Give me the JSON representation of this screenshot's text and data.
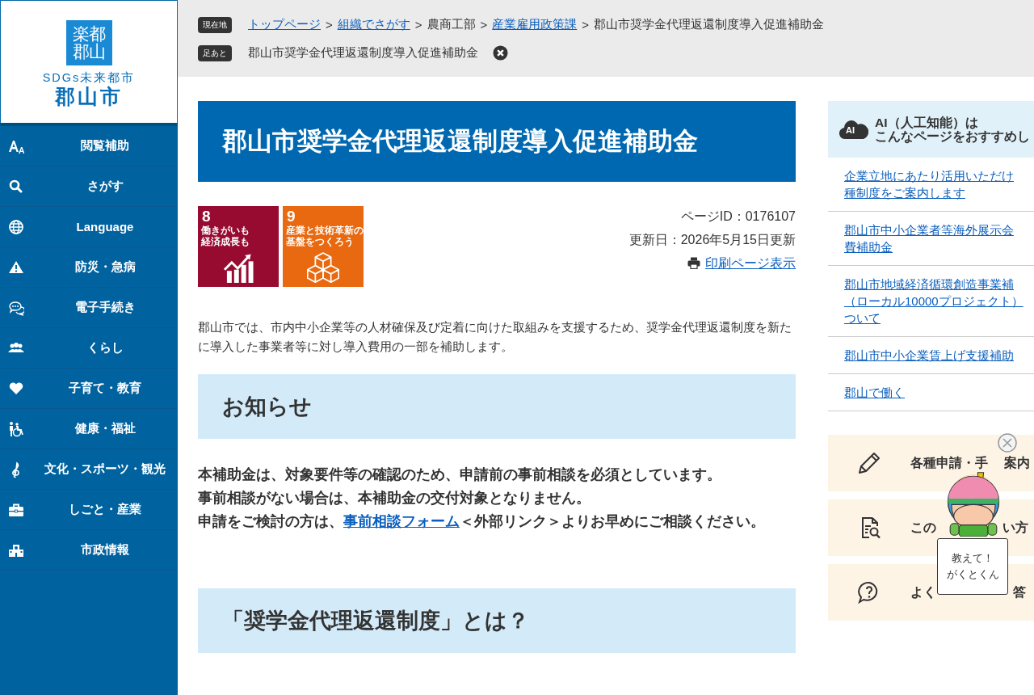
{
  "logo": {
    "mark_lines": [
      "楽都",
      "郡山"
    ],
    "tagline": "SDGs未来都市",
    "city": "郡山市"
  },
  "sidebar": {
    "items": [
      {
        "label": "閲覧補助"
      },
      {
        "label": "さがす"
      },
      {
        "label": "Language"
      },
      {
        "label": "防災・急病"
      },
      {
        "label": "電子手続き"
      },
      {
        "label": "くらし"
      },
      {
        "label": "子育て・教育"
      },
      {
        "label": "健康・福祉"
      },
      {
        "label": "文化・スポーツ・観光"
      },
      {
        "label": "しごと・産業"
      },
      {
        "label": "市政情報"
      }
    ]
  },
  "breadcrumb": {
    "label": "現在地",
    "items": [
      {
        "kind": "link",
        "text": "トップページ"
      },
      {
        "kind": "sep",
        "text": ">"
      },
      {
        "kind": "link",
        "text": "組織でさがす"
      },
      {
        "kind": "sep",
        "text": ">"
      },
      {
        "kind": "plain",
        "text": "農商工部"
      },
      {
        "kind": "sep",
        "text": ">"
      },
      {
        "kind": "link",
        "text": "産業雇用政策課"
      },
      {
        "kind": "sep",
        "text": ">"
      },
      {
        "kind": "plain",
        "text": "郡山市奨学金代理返還制度導入促進補助金"
      }
    ]
  },
  "footprint": {
    "label": "足あと",
    "text": "郡山市奨学金代理返還制度導入促進補助金"
  },
  "page_title": "郡山市奨学金代理返還制度導入促進補助金",
  "sdgs": [
    {
      "number": "8",
      "lines": [
        "働きがいも",
        "経済成長も"
      ],
      "color": "#970b31"
    },
    {
      "number": "9",
      "lines": [
        "産業と技術革新の",
        "基盤をつくろう"
      ],
      "color": "#e8690f"
    }
  ],
  "meta": {
    "page_id": "ページID：0176107",
    "updated": "更新日：2026年5月15日更新",
    "print_link": "印刷ページ表示"
  },
  "intro": "郡山市では、市内中小企業等の人材確保及び定着に向けた取組みを支援するため、奨学金代理返還制度を新たに導入した事業者等に対し導入費用の一部を補助します。",
  "notice": {
    "heading": "お知らせ",
    "paragraphs": [
      {
        "text": "本補助金は、対象要件等の確認のため、申請前の事前相談を必須としています。"
      },
      {
        "text": "事前相談がない場合は、本補助金の交付対象となりません。"
      },
      {
        "before": "申請をご検討の方は、",
        "link": "事前相談フォーム",
        "after": "＜外部リンク＞よりお早めにご相談ください。"
      }
    ]
  },
  "section_heading": "「奨学金代理返還制度」とは？",
  "ai_recommend": {
    "badge": "AI",
    "title_lines": [
      "AI（人工知能）は",
      "こんなページをおすすめし"
    ],
    "links": [
      {
        "lines": [
          "企業立地にあたり活用いただけ",
          "種制度をご案内します"
        ]
      },
      {
        "lines": [
          "郡山市中小企業者等海外展示会",
          "費補助金"
        ]
      },
      {
        "lines": [
          "郡山市地域経済循環創造事業補",
          "（ローカル10000プロジェクト）",
          "ついて"
        ]
      },
      {
        "lines": [
          "郡山市中小企業賃上げ支援補助"
        ]
      },
      {
        "lines": [
          "郡山で働く"
        ]
      }
    ]
  },
  "quick_links": [
    {
      "parts": [
        "各種申請・手",
        "案内"
      ]
    },
    {
      "parts": [
        "この",
        "い方"
      ]
    },
    {
      "parts": [
        "よく",
        "答"
      ]
    }
  ],
  "mascot": {
    "sign_lines": [
      "教えて！",
      "がくとくん"
    ]
  }
}
